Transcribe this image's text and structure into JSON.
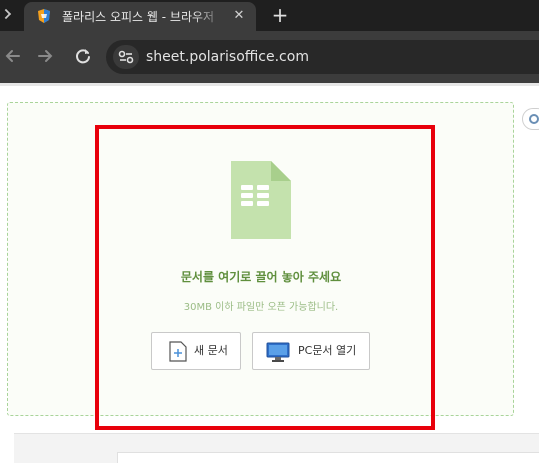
{
  "browser": {
    "tab": {
      "title": "폴라리스 오피스 웹 - 브라우저",
      "close_glyph": "✕",
      "favicon": "polaris-office-icon"
    },
    "new_tab_glyph": "+",
    "url": "sheet.polarisoffice.com",
    "icons": {
      "back": "arrow-left-icon",
      "forward": "arrow-right-icon",
      "reload": "reload-icon",
      "site_info": "tune-icon"
    }
  },
  "dropzone": {
    "heading": "문서를 여기로 끌어 놓아 주세요",
    "subtext": "30MB 이하 파일만 오픈 가능합니다.",
    "new_document_label": "새 문서",
    "open_pc_label": "PC문서 열기",
    "icon": "spreadsheet-file-icon"
  },
  "colors": {
    "accent_green": "#5f8f3d",
    "icon_green": "#c4e2ad",
    "highlight_red": "#e8000b"
  }
}
